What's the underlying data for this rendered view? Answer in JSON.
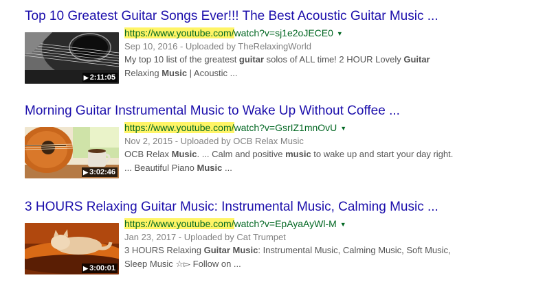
{
  "results": [
    {
      "title": "Top 10 Greatest Guitar Songs Ever!!! The Best Acoustic Guitar Music ...",
      "url_host": "https://www.youtube.com/",
      "url_rest": "watch?v=sj1e2oJECE0",
      "duration": "2:11:05",
      "date_uploader": "Sep 10, 2016 - Uploaded by TheRelaxingWorld",
      "snippet_lines": [
        [
          {
            "t": "My top 10 list of the greatest "
          },
          {
            "t": "guitar",
            "b": true
          },
          {
            "t": " solos of ALL time! 2 HOUR Lovely "
          },
          {
            "t": "Guitar",
            "b": true
          }
        ],
        [
          {
            "t": "Relaxing "
          },
          {
            "t": "Music",
            "b": true
          },
          {
            "t": " | Acoustic ..."
          }
        ]
      ],
      "thumb_icon": "acoustic-guitar-thumbnail"
    },
    {
      "title": "Morning Guitar Instrumental Music to Wake Up Without Coffee ...",
      "url_host": "https://www.youtube.com/",
      "url_rest": "watch?v=GsrIZ1mnOvU",
      "duration": "3:02:46",
      "date_uploader": "Nov 2, 2015 - Uploaded by OCB Relax Music",
      "snippet_lines": [
        [
          {
            "t": "OCB Relax "
          },
          {
            "t": "Music",
            "b": true
          },
          {
            "t": ". ... Calm and positive "
          },
          {
            "t": "music",
            "b": true
          },
          {
            "t": " to wake up and start your day right."
          }
        ],
        [
          {
            "t": "... Beautiful Piano "
          },
          {
            "t": "Music",
            "b": true
          },
          {
            "t": " ..."
          }
        ]
      ],
      "thumb_icon": "guitar-coffee-thumbnail"
    },
    {
      "title": "3 HOURS Relaxing Guitar Music: Instrumental Music, Calming Music ...",
      "url_host": "https://www.youtube.com/",
      "url_rest": "watch?v=EpAyaAyWl-M",
      "duration": "3:00:01",
      "date_uploader": "Jan 23, 2017 - Uploaded by Cat Trumpet",
      "snippet_lines": [
        [
          {
            "t": "3 HOURS Relaxing "
          },
          {
            "t": "Guitar Music",
            "b": true
          },
          {
            "t": ": Instrumental Music, Calming Music, Soft Music,"
          }
        ],
        [
          {
            "t": "Sleep Music ☆▻ Follow on ..."
          }
        ]
      ],
      "thumb_icon": "sleeping-cat-thumbnail"
    }
  ],
  "colors": {
    "title_link": "#1a0dab",
    "url_green": "#006621",
    "url_highlight": "#fff466",
    "date_gray": "#808080",
    "snippet_gray": "#545454"
  },
  "play_glyph": "▶",
  "caret_glyph": "▼"
}
